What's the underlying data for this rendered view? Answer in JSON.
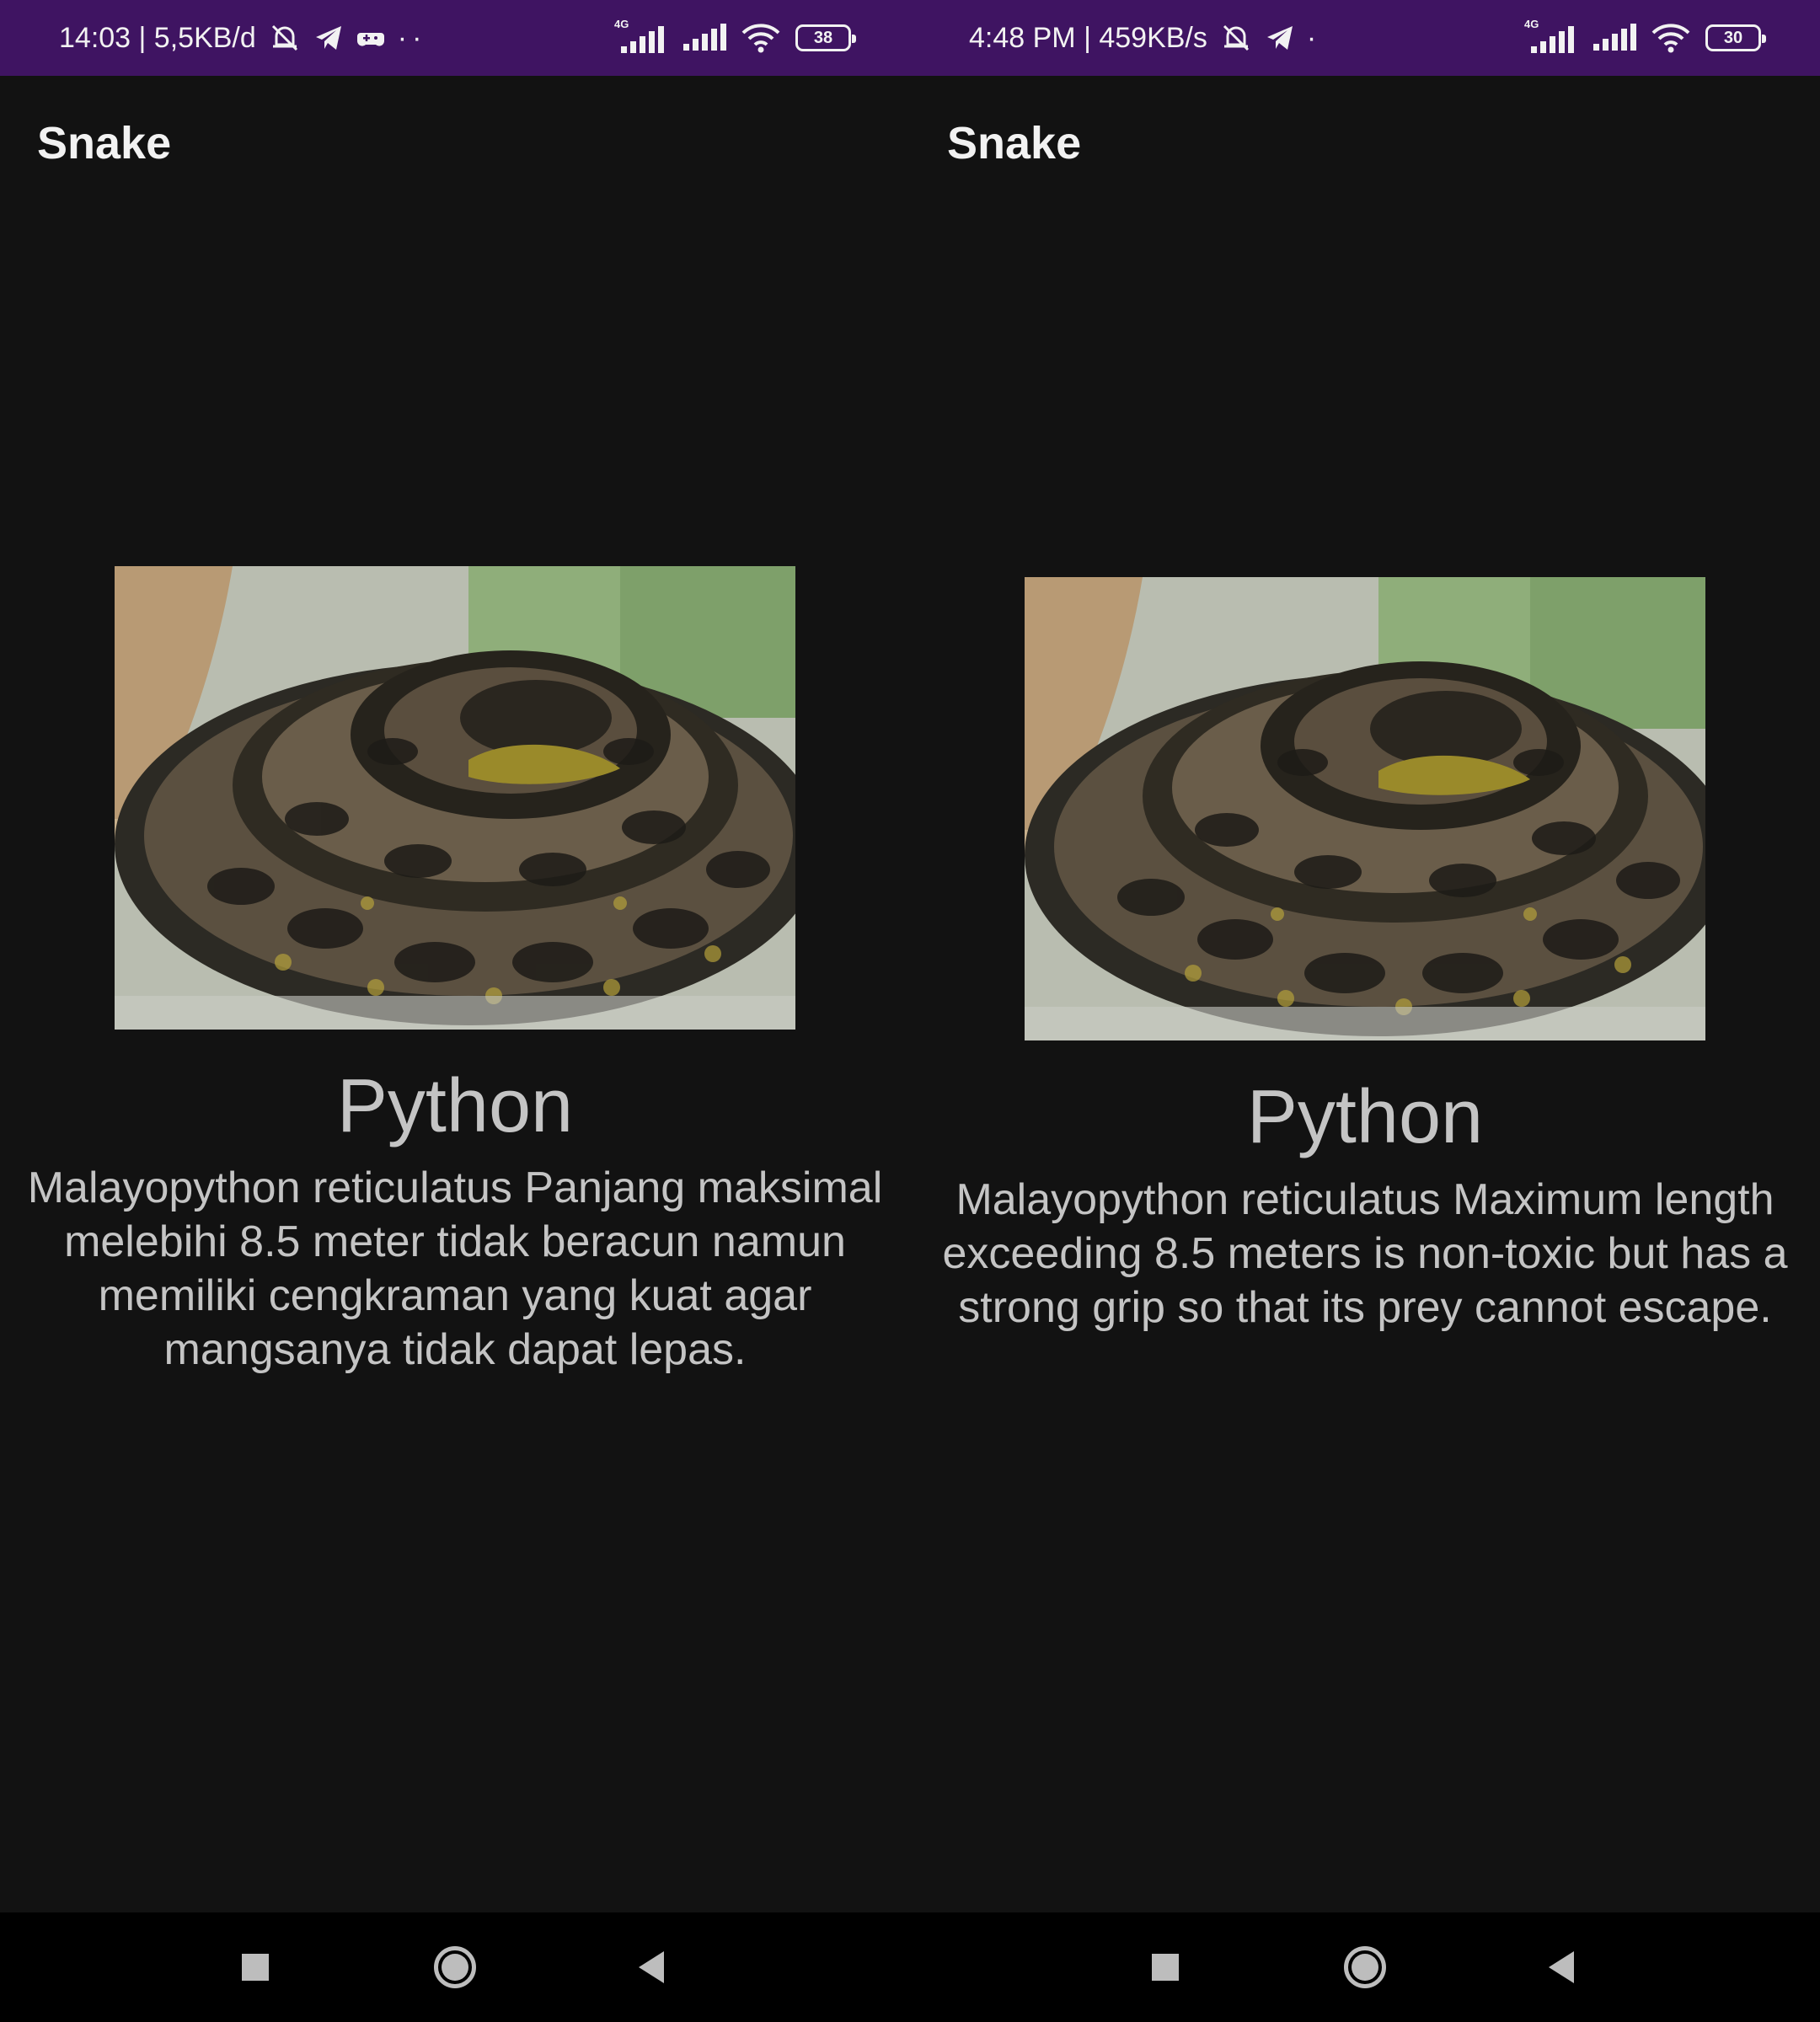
{
  "screens": [
    {
      "status_bar": {
        "time_speed": "14:03 | 5,5KB/d",
        "net_tag": "4G",
        "battery": "38",
        "extra": "··"
      },
      "app_bar": {
        "title": "Snake"
      },
      "snake": {
        "name": "Python",
        "description": "Malayopython reticulatus Panjang maksimal melebihi 8.5 meter tidak beracun namun memiliki cengkraman yang kuat agar mangsanya tidak dapat lepas."
      },
      "nav": [
        "recents-button",
        "home-button",
        "back-button"
      ]
    },
    {
      "status_bar": {
        "time_speed": "4:48 PM | 459KB/s",
        "net_tag": "4G",
        "battery": "30",
        "extra": "·"
      },
      "app_bar": {
        "title": "Snake"
      },
      "snake": {
        "name": "Python",
        "description": "Malayopython reticulatus Maximum length exceeding 8.5 meters is non-toxic but has a strong grip so that its prey cannot escape."
      },
      "nav": [
        "recents-button",
        "home-button",
        "back-button"
      ]
    }
  ],
  "colors": {
    "status_bar": "#3f1462",
    "background": "#121212",
    "text_primary": "#f2f2f2",
    "text_secondary": "#c4c4c4",
    "nav_bar": "#000000"
  },
  "icons": {
    "status_left": [
      "muted-bell-icon",
      "telegram-icon",
      "game-controller-icon"
    ],
    "status_right": [
      "signal-4g-icon",
      "signal-icon",
      "wifi-icon",
      "battery-icon"
    ]
  }
}
